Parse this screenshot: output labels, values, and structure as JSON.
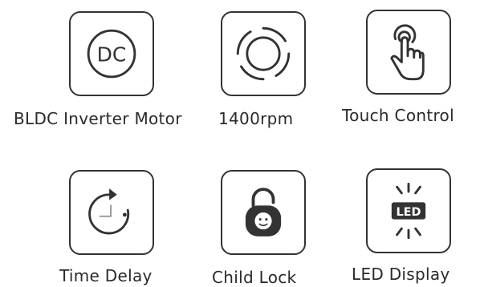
{
  "features": [
    {
      "label": "BLDC Inverter Motor",
      "icon": "dc-motor-icon",
      "icon_text": "DC"
    },
    {
      "label": "1400rpm",
      "icon": "rotation-rings-icon"
    },
    {
      "label": "Touch Control",
      "icon": "touch-hand-icon"
    },
    {
      "label": "Time Delay",
      "icon": "timer-icon"
    },
    {
      "label": "Child Lock",
      "icon": "child-lock-icon"
    },
    {
      "label": "LED Display",
      "icon": "led-display-icon",
      "icon_text": "LED"
    }
  ],
  "colors": {
    "icon_stroke": "#333333",
    "text": "#2a2a2a",
    "background": "#ffffff"
  }
}
